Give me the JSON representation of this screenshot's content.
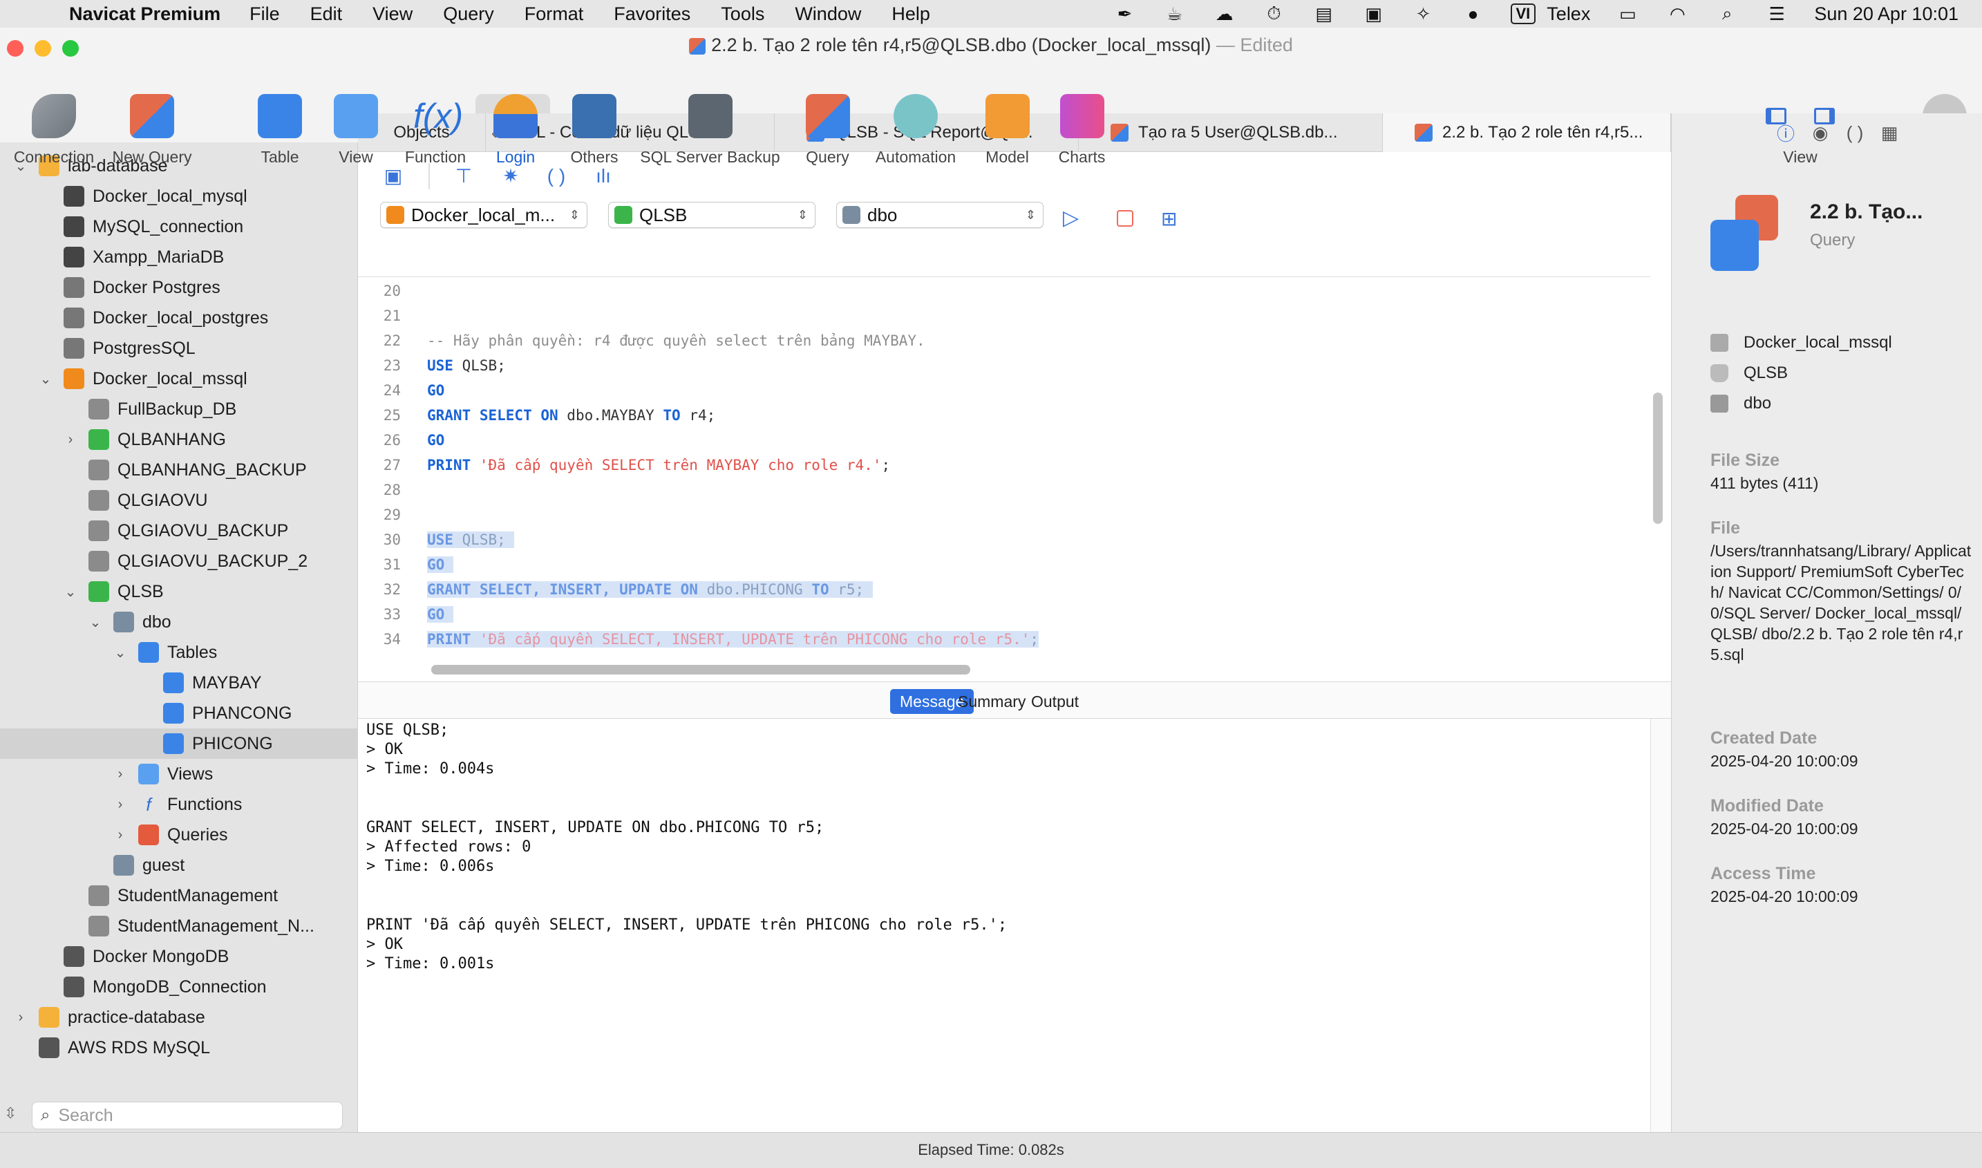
{
  "menubar": {
    "app_name": "Navicat Premium",
    "items": [
      "File",
      "Edit",
      "View",
      "Query",
      "Format",
      "Favorites",
      "Tools",
      "Window",
      "Help"
    ],
    "input_method": "VI",
    "input_name": "Telex",
    "datetime": "Sun 20 Apr  10:01"
  },
  "window": {
    "title": "2.2 b. Tạo 2 role tên r4,r5@QLSB.dbo (Docker_local_mssql)",
    "edited": "— Edited"
  },
  "toolbar": {
    "items": [
      {
        "label": "Connection",
        "icon": "connection-icon"
      },
      {
        "label": "New Query",
        "icon": "new-query-icon"
      },
      {
        "label": "Table",
        "icon": "table-icon"
      },
      {
        "label": "View",
        "icon": "view-icon"
      },
      {
        "label": "Function",
        "icon": "function-icon"
      },
      {
        "label": "Login",
        "icon": "login-icon"
      },
      {
        "label": "Others",
        "icon": "others-icon"
      },
      {
        "label": "SQL Server Backup",
        "icon": "backup-icon"
      },
      {
        "label": "Query",
        "icon": "query-icon"
      },
      {
        "label": "Automation",
        "icon": "automation-icon"
      },
      {
        "label": "Model",
        "icon": "model-icon"
      },
      {
        "label": "Charts",
        "icon": "charts-icon"
      }
    ],
    "view_label": "View"
  },
  "sidebar": {
    "items": [
      {
        "label": "lab-database",
        "icon": "folder-icon"
      },
      {
        "label": "Docker_local_mysql",
        "icon": "mysql-icon"
      },
      {
        "label": "MySQL_connection",
        "icon": "mysql-icon"
      },
      {
        "label": "Xampp_MariaDB",
        "icon": "mysql-icon"
      },
      {
        "label": "Docker Postgres",
        "icon": "postgres-icon"
      },
      {
        "label": "Docker_local_postgres",
        "icon": "postgres-icon"
      },
      {
        "label": "PostgresSQL",
        "icon": "postgres-icon"
      },
      {
        "label": "Docker_local_mssql",
        "icon": "mssql-icon"
      },
      {
        "label": "FullBackup_DB",
        "icon": "database-icon"
      },
      {
        "label": "QLBANHANG",
        "icon": "database-icon"
      },
      {
        "label": "QLBANHANG_BACKUP",
        "icon": "database-icon"
      },
      {
        "label": "QLGIAOVU",
        "icon": "database-icon"
      },
      {
        "label": "QLGIAOVU_BACKUP",
        "icon": "database-icon"
      },
      {
        "label": "QLGIAOVU_BACKUP_2",
        "icon": "database-icon"
      },
      {
        "label": "QLSB",
        "icon": "database-icon"
      },
      {
        "label": "dbo",
        "icon": "schema-icon"
      },
      {
        "label": "Tables",
        "icon": "tables-icon"
      },
      {
        "label": "MAYBAY",
        "icon": "table-icon"
      },
      {
        "label": "PHANCONG",
        "icon": "table-icon"
      },
      {
        "label": "PHICONG",
        "icon": "table-icon"
      },
      {
        "label": "Views",
        "icon": "views-icon"
      },
      {
        "label": "Functions",
        "icon": "functions-icon"
      },
      {
        "label": "Queries",
        "icon": "queries-icon"
      },
      {
        "label": "guest",
        "icon": "schema-icon"
      },
      {
        "label": "StudentManagement",
        "icon": "database-icon"
      },
      {
        "label": "StudentManagement_N...",
        "icon": "database-icon"
      },
      {
        "label": "Docker MongoDB",
        "icon": "mongodb-icon"
      },
      {
        "label": "MongoDB_Connection",
        "icon": "mongodb-icon"
      },
      {
        "label": "practice-database",
        "icon": "folder-icon"
      },
      {
        "label": "AWS RDS MySQL",
        "icon": "aws-icon"
      }
    ],
    "search_placeholder": "Search"
  },
  "tabs": [
    {
      "label": "Objects"
    },
    {
      "label": "DDL - Cơ sở dữ liệu QLS..."
    },
    {
      "label": "QLSB - SQL Report@QL..."
    },
    {
      "label": "Tạo ra 5 User@QLSB.db..."
    },
    {
      "label": "2.2 b. Tạo 2 role tên r4,r5..."
    }
  ],
  "selectors": {
    "connection": "Docker_local_m...",
    "database": "QLSB",
    "schema": "dbo"
  },
  "code_lines": [
    {
      "num": "20",
      "tokens": []
    },
    {
      "num": "21",
      "tokens": []
    },
    {
      "num": "22",
      "tokens": [
        {
          "t": "-- Hãy phân quyền: r4 được quyền select trên bảng MAYBAY.",
          "c": "cmt"
        }
      ]
    },
    {
      "num": "23",
      "tokens": [
        {
          "t": "USE",
          "c": "kw"
        },
        {
          "t": " QLSB;",
          "c": "plain"
        }
      ]
    },
    {
      "num": "24",
      "tokens": [
        {
          "t": "GO",
          "c": "kw"
        }
      ]
    },
    {
      "num": "25",
      "tokens": [
        {
          "t": "GRANT SELECT ON",
          "c": "kw"
        },
        {
          "t": " dbo.MAYBAY ",
          "c": "plain"
        },
        {
          "t": "TO",
          "c": "kw"
        },
        {
          "t": " r4;",
          "c": "plain"
        }
      ]
    },
    {
      "num": "26",
      "tokens": [
        {
          "t": "GO",
          "c": "kw"
        }
      ]
    },
    {
      "num": "27",
      "tokens": [
        {
          "t": "PRINT",
          "c": "kw"
        },
        {
          "t": " ",
          "c": "plain"
        },
        {
          "t": "'Đã cấp quyền SELECT trên MAYBAY cho role r4.'",
          "c": "str"
        },
        {
          "t": ";",
          "c": "plain"
        }
      ]
    },
    {
      "num": "28",
      "tokens": []
    },
    {
      "num": "29",
      "tokens": []
    },
    {
      "num": "30",
      "sel": true,
      "tokens": [
        {
          "t": "USE",
          "c": "kw"
        },
        {
          "t": " QLSB; ",
          "c": "plain"
        }
      ]
    },
    {
      "num": "31",
      "sel": true,
      "tokens": [
        {
          "t": "GO",
          "c": "kw"
        },
        {
          "t": " ",
          "c": "plain"
        }
      ]
    },
    {
      "num": "32",
      "sel": true,
      "tokens": [
        {
          "t": "GRANT SELECT, INSERT, UPDATE ON",
          "c": "kw"
        },
        {
          "t": " dbo.PHICONG ",
          "c": "plain"
        },
        {
          "t": "TO",
          "c": "kw"
        },
        {
          "t": " r5; ",
          "c": "plain"
        }
      ]
    },
    {
      "num": "33",
      "sel": true,
      "tokens": [
        {
          "t": "GO",
          "c": "kw"
        },
        {
          "t": " ",
          "c": "plain"
        }
      ]
    },
    {
      "num": "34",
      "sel": true,
      "tokens": [
        {
          "t": "PRINT",
          "c": "kw"
        },
        {
          "t": " ",
          "c": "plain"
        },
        {
          "t": "'Đã cấp quyền SELECT, INSERT, UPDATE trên PHICONG cho role r5.'",
          "c": "str"
        },
        {
          "t": ";",
          "c": "plain"
        }
      ]
    }
  ],
  "result_tabs": {
    "message": "Message",
    "summary": "Summary",
    "output": "Output"
  },
  "output_lines": [
    "USE QLSB;",
    "> OK",
    "> Time: 0.004s",
    "",
    "",
    "GRANT SELECT, INSERT, UPDATE ON dbo.PHICONG TO r5;",
    "> Affected rows: 0",
    "> Time: 0.006s",
    "",
    "",
    "PRINT 'Đã cấp quyền SELECT, INSERT, UPDATE trên PHICONG cho role r5.';",
    "> OK",
    "> Time: 0.001s"
  ],
  "right_panel": {
    "title": "2.2 b. Tạo...",
    "subtitle": "Query",
    "connection": "Docker_local_mssql",
    "database": "QLSB",
    "schema": "dbo",
    "file_size_label": "File Size",
    "file_size": "411 bytes (411)",
    "file_label": "File",
    "file_path": "/Users/trannhatsang/Library/ Application Support/ PremiumSoft CyberTech/ Navicat CC/Common/Settings/ 0/0/SQL Server/ Docker_local_mssql/QLSB/ dbo/2.2 b. Tạo 2 role tên r4,r5.sql",
    "created_label": "Created Date",
    "created": "2025-04-20 10:00:09",
    "modified_label": "Modified Date",
    "modified": "2025-04-20 10:00:09",
    "access_label": "Access Time",
    "access": "2025-04-20 10:00:09"
  },
  "status": {
    "elapsed": "Elapsed Time: 0.082s"
  }
}
